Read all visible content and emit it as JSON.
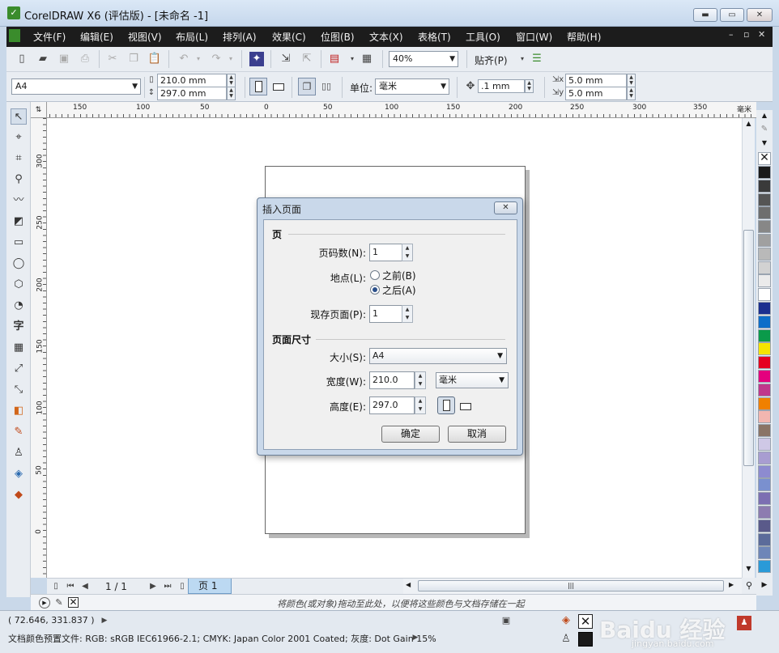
{
  "window": {
    "title": "CorelDRAW X6 (评估版) - [未命名 -1]",
    "icon_name": "coreldraw-icon"
  },
  "menu": [
    "文件(F)",
    "编辑(E)",
    "视图(V)",
    "布局(L)",
    "排列(A)",
    "效果(C)",
    "位图(B)",
    "文本(X)",
    "表格(T)",
    "工具(O)",
    "窗口(W)",
    "帮助(H)"
  ],
  "toolbar": {
    "zoom": "40%",
    "snap": "贴齐(P)"
  },
  "propbar": {
    "paper_size": "A4",
    "width": "210.0 mm",
    "height": "297.0 mm",
    "units_label": "单位:",
    "units": "毫米",
    "nudge": ".1 mm",
    "dup_x": "5.0 mm",
    "dup_y": "5.0 mm"
  },
  "ruler": {
    "unit": "毫米",
    "h_ticks": [
      "150",
      "100",
      "50",
      "0",
      "50",
      "100",
      "150",
      "200",
      "250",
      "300",
      "350"
    ],
    "v_ticks": [
      "300",
      "250",
      "200",
      "150",
      "100",
      "50",
      "0"
    ]
  },
  "pagenav": {
    "counter": "1 / 1",
    "tab": "页 1"
  },
  "hint": "将颜色(或对象)拖动至此处，以便将这些颜色与文档存储在一起",
  "status": {
    "coords": "( 72.646, 331.837 )",
    "profiles": "文档颜色预置文件: RGB: sRGB IEC61966-2.1; CMYK: Japan Color 2001 Coated; 灰度: Dot Gain 15%"
  },
  "palette": [
    "#1a1a1a",
    "#3a3a3a",
    "#555555",
    "#6e6e6e",
    "#878787",
    "#a0a0a0",
    "#b9b9b9",
    "#d2d2d2",
    "#ebebeb",
    "#ffffff",
    "#1b2f8f",
    "#0d6ec9",
    "#0a9a4a",
    "#f5e400",
    "#e5001f",
    "#e4007e",
    "#c0378c",
    "#f08000",
    "#f2b6b0",
    "#8a7466",
    "#cfc8e6",
    "#a89dd1",
    "#8d8bd0",
    "#7a90cf",
    "#7c6fb2",
    "#8d7cb0",
    "#5a5a8a",
    "#5b6b9a",
    "#6e86b8",
    "#2a9ad8"
  ],
  "dialog": {
    "title": "插入页面",
    "section_page": "页",
    "pages_label": "页码数(N):",
    "pages_value": "1",
    "location_label": "地点(L):",
    "before_label": "之前(B)",
    "after_label": "之后(A)",
    "existing_label": "现存页面(P):",
    "existing_value": "1",
    "section_size": "页面尺寸",
    "size_label": "大小(S):",
    "size_value": "A4",
    "width_label": "宽度(W):",
    "width_value": "210.0",
    "unit_value": "毫米",
    "height_label": "高度(E):",
    "height_value": "297.0",
    "ok": "确定",
    "cancel": "取消"
  },
  "watermark": {
    "brand": "Baidu 经验",
    "url": "jingyan.baidu.com"
  }
}
